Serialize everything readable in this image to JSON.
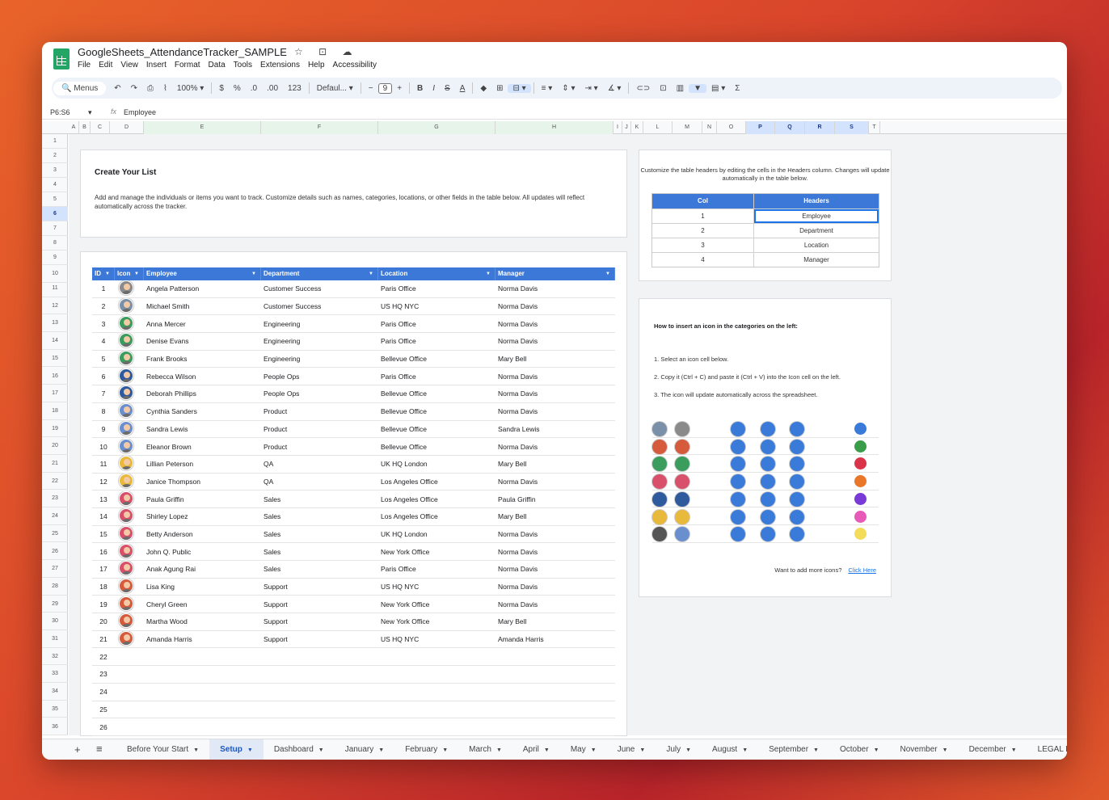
{
  "app": {
    "title": "GoogleSheets_AttendanceTracker_SAMPLE",
    "title_icons": "☆ ⊡ ☁"
  },
  "menu": [
    "File",
    "Edit",
    "View",
    "Insert",
    "Format",
    "Data",
    "Tools",
    "Extensions",
    "Help",
    "Accessibility"
  ],
  "toolbar": {
    "search": "Menus",
    "zoom": "100%",
    "currency": "$",
    "percent": "%",
    "dec_less": ".0",
    "dec_more": ".00",
    "number_fmt": "123",
    "font": "Defaul...",
    "font_size": "9",
    "minus": "−",
    "plus": "+",
    "bold": "B",
    "italic": "I",
    "strike": "S",
    "textcolor": "A",
    "sum": "Σ"
  },
  "formula": {
    "cell_ref": "P6:S6",
    "fx": "fx",
    "value": "Employee"
  },
  "columns": [
    "A",
    "B",
    "C",
    "D",
    "E",
    "F",
    "G",
    "H",
    "I",
    "J",
    "K",
    "L",
    "M",
    "N",
    "O",
    "P",
    "Q",
    "R",
    "S",
    "T"
  ],
  "rows": [
    "1",
    "2",
    "3",
    "4",
    "5",
    "6",
    "7",
    "8",
    "9",
    "10",
    "11",
    "12",
    "13",
    "14",
    "15",
    "16",
    "17",
    "18",
    "19",
    "20",
    "21",
    "22",
    "23",
    "24",
    "25",
    "26",
    "27",
    "28",
    "29",
    "30",
    "31",
    "32",
    "33",
    "34",
    "35",
    "36"
  ],
  "intro": {
    "title": "Create Your List",
    "text": "Add and manage the individuals or items you want to track. Customize details such as names, categories, locations, or other fields in the table below. All updates will reflect automatically across the tracker."
  },
  "table": {
    "headers": [
      "ID",
      "Icon",
      "Employee",
      "Department",
      "Location",
      "Manager"
    ],
    "rows": [
      {
        "id": "1",
        "employee": "Angela Patterson",
        "department": "Customer Success",
        "location": "Paris Office",
        "manager": "Norma Davis"
      },
      {
        "id": "2",
        "employee": "Michael Smith",
        "department": "Customer Success",
        "location": "US HQ NYC",
        "manager": "Norma Davis"
      },
      {
        "id": "3",
        "employee": "Anna Mercer",
        "department": "Engineering",
        "location": "Paris Office",
        "manager": "Norma Davis"
      },
      {
        "id": "4",
        "employee": "Denise Evans",
        "department": "Engineering",
        "location": "Paris Office",
        "manager": "Norma Davis"
      },
      {
        "id": "5",
        "employee": "Frank Brooks",
        "department": "Engineering",
        "location": "Bellevue Office",
        "manager": "Mary Bell"
      },
      {
        "id": "6",
        "employee": "Rebecca Wilson",
        "department": "People Ops",
        "location": "Paris Office",
        "manager": "Norma Davis"
      },
      {
        "id": "7",
        "employee": "Deborah Phillips",
        "department": "People Ops",
        "location": "Bellevue Office",
        "manager": "Norma Davis"
      },
      {
        "id": "8",
        "employee": "Cynthia Sanders",
        "department": "Product",
        "location": "Bellevue Office",
        "manager": "Norma Davis"
      },
      {
        "id": "9",
        "employee": "Sandra Lewis",
        "department": "Product",
        "location": "Bellevue Office",
        "manager": "Sandra Lewis"
      },
      {
        "id": "10",
        "employee": "Eleanor Brown",
        "department": "Product",
        "location": "Bellevue Office",
        "manager": "Norma Davis"
      },
      {
        "id": "11",
        "employee": "Lillian Peterson",
        "department": "QA",
        "location": "UK HQ London",
        "manager": "Mary Bell"
      },
      {
        "id": "12",
        "employee": "Janice Thompson",
        "department": "QA",
        "location": "Los Angeles Office",
        "manager": "Norma Davis"
      },
      {
        "id": "13",
        "employee": "Paula Griffin",
        "department": "Sales",
        "location": "Los Angeles Office",
        "manager": "Paula Griffin"
      },
      {
        "id": "14",
        "employee": "Shirley Lopez",
        "department": "Sales",
        "location": "Los Angeles Office",
        "manager": "Mary Bell"
      },
      {
        "id": "15",
        "employee": "Betty Anderson",
        "department": "Sales",
        "location": "UK HQ London",
        "manager": "Norma Davis"
      },
      {
        "id": "16",
        "employee": "John Q. Public",
        "department": "Sales",
        "location": "New York Office",
        "manager": "Norma Davis"
      },
      {
        "id": "17",
        "employee": "Anak Agung Rai",
        "department": "Sales",
        "location": "Paris Office",
        "manager": "Norma Davis"
      },
      {
        "id": "18",
        "employee": "Lisa King",
        "department": "Support",
        "location": "US HQ NYC",
        "manager": "Norma Davis"
      },
      {
        "id": "19",
        "employee": "Cheryl Green",
        "department": "Support",
        "location": "New York Office",
        "manager": "Norma Davis"
      },
      {
        "id": "20",
        "employee": "Martha Wood",
        "department": "Support",
        "location": "New York Office",
        "manager": "Mary Bell"
      },
      {
        "id": "21",
        "employee": "Amanda Harris",
        "department": "Support",
        "location": "US HQ NYC",
        "manager": "Amanda Harris"
      },
      {
        "id": "22",
        "employee": "",
        "department": "",
        "location": "",
        "manager": ""
      },
      {
        "id": "23",
        "employee": "",
        "department": "",
        "location": "",
        "manager": ""
      },
      {
        "id": "24",
        "employee": "",
        "department": "",
        "location": "",
        "manager": ""
      },
      {
        "id": "25",
        "employee": "",
        "department": "",
        "location": "",
        "manager": ""
      },
      {
        "id": "26",
        "employee": "",
        "department": "",
        "location": "",
        "manager": ""
      }
    ],
    "avatar_colors": [
      "#8a8a8a",
      "#7a8fa8",
      "#3a9d5d",
      "#3a9d5d",
      "#3a9d5d",
      "#2f5a9e",
      "#2f5a9e",
      "#6a8fcf",
      "#6a8fcf",
      "#6a8fcf",
      "#e8b93a",
      "#e8b93a",
      "#d9506a",
      "#d9506a",
      "#d9506a",
      "#d9506a",
      "#d9506a",
      "#d65a3c",
      "#d65a3c",
      "#d65a3c",
      "#d65a3c"
    ]
  },
  "headers_card": {
    "note": "Customize the table headers by editing the cells in the Headers column. Changes will update automatically in the table below.",
    "col_label": "Col",
    "headers_label": "Headers",
    "rows": [
      {
        "col": "1",
        "header": "Employee"
      },
      {
        "col": "2",
        "header": "Department"
      },
      {
        "col": "3",
        "header": "Location"
      },
      {
        "col": "4",
        "header": "Manager"
      }
    ]
  },
  "icons_card": {
    "title": "How to insert an icon in the categories on the left:",
    "steps": [
      "1. Select an icon cell below.",
      "2. Copy it (Ctrl + C) and paste it (Ctrl + V) into the Icon cell on the left.",
      "3. The icon will update automatically across the spreadsheet."
    ],
    "people_colors": [
      [
        "#7a8fa8",
        "#8a8a8a"
      ],
      [
        "#d65a3c",
        "#d65a3c"
      ],
      [
        "#3a9d5d",
        "#3a9d5d"
      ],
      [
        "#d9506a",
        "#d9506a"
      ],
      [
        "#2f5a9e",
        "#2f5a9e"
      ],
      [
        "#e8b93a",
        "#e8b93a"
      ],
      [
        "#555555",
        "#6a8fcf"
      ]
    ],
    "animal_colors": [
      [
        "#3a7ad8",
        "#3a7ad8",
        "#3a7ad8"
      ],
      [
        "#3a7ad8",
        "#3a7ad8",
        "#3a7ad8"
      ],
      [
        "#3a7ad8",
        "#3a7ad8",
        "#3a7ad8"
      ],
      [
        "#3a7ad8",
        "#3a7ad8",
        "#3a7ad8"
      ],
      [
        "#3a7ad8",
        "#3a7ad8",
        "#3a7ad8"
      ],
      [
        "#3a7ad8",
        "#3a7ad8",
        "#3a7ad8"
      ],
      [
        "#3a7ad8",
        "#3a7ad8",
        "#3a7ad8"
      ]
    ],
    "dot_colors": [
      "#3a7ad8",
      "#3a9d4a",
      "#d9344a",
      "#e8772a",
      "#7a3ad8",
      "#e85ab8",
      "#f3dc5a"
    ],
    "more_text": "Want to add more icons?",
    "more_link": "Click Here"
  },
  "tabs": [
    {
      "label": "Before Your Start",
      "active": false
    },
    {
      "label": "Setup",
      "active": true
    },
    {
      "label": "Dashboard",
      "active": false
    },
    {
      "label": "January",
      "active": false
    },
    {
      "label": "February",
      "active": false
    },
    {
      "label": "March",
      "active": false
    },
    {
      "label": "April",
      "active": false
    },
    {
      "label": "May",
      "active": false
    },
    {
      "label": "June",
      "active": false
    },
    {
      "label": "July",
      "active": false
    },
    {
      "label": "August",
      "active": false
    },
    {
      "label": "September",
      "active": false
    },
    {
      "label": "October",
      "active": false
    },
    {
      "label": "November",
      "active": false
    },
    {
      "label": "December",
      "active": false
    },
    {
      "label": "LEGAL DISCLA",
      "active": false
    }
  ]
}
